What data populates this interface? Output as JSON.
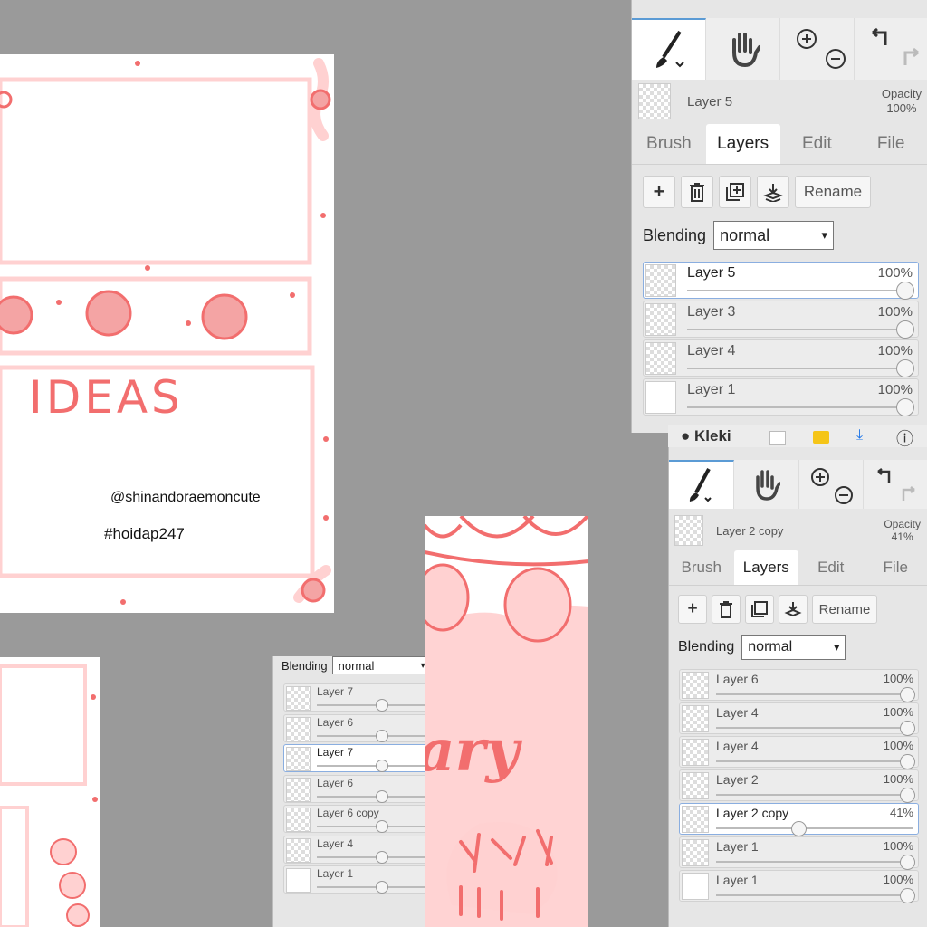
{
  "canvas1": {
    "ideas_text": "IDEAS",
    "handle": "@shinandoraemoncute",
    "hashtag": "#hoidap247"
  },
  "canvas2": {
    "art_text": "ary"
  },
  "panel_top": {
    "current_layer": "Layer 5",
    "opacity_label": "Opacity",
    "opacity_value": "100%",
    "tabs": [
      "Brush",
      "Layers",
      "Edit",
      "File"
    ],
    "rename": "Rename",
    "blending_label": "Blending",
    "blending_value": "normal",
    "layers": [
      {
        "name": "Layer 5",
        "opacity": "100%",
        "level": 1.0,
        "selected": true
      },
      {
        "name": "Layer 3",
        "opacity": "100%",
        "level": 1.0,
        "selected": false
      },
      {
        "name": "Layer 4",
        "opacity": "100%",
        "level": 1.0,
        "selected": false
      },
      {
        "name": "Layer 1",
        "opacity": "100%",
        "level": 1.0,
        "selected": false
      }
    ]
  },
  "kleki_bar": {
    "logo_text": "Kleki"
  },
  "panel_right": {
    "current_layer": "Layer 2 copy",
    "opacity_label": "Opacity",
    "opacity_value": "41%",
    "tabs": [
      "Brush",
      "Layers",
      "Edit",
      "File"
    ],
    "rename": "Rename",
    "blending_label": "Blending",
    "blending_value": "normal",
    "layers": [
      {
        "name": "Layer 6",
        "opacity": "100%",
        "level": 1.0,
        "selected": false
      },
      {
        "name": "Layer 4",
        "opacity": "100%",
        "level": 1.0,
        "selected": false
      },
      {
        "name": "Layer 4",
        "opacity": "100%",
        "level": 1.0,
        "selected": false
      },
      {
        "name": "Layer 2",
        "opacity": "100%",
        "level": 1.0,
        "selected": false
      },
      {
        "name": "Layer 2 copy",
        "opacity": "41%",
        "level": 0.41,
        "selected": true
      },
      {
        "name": "Layer 1",
        "opacity": "100%",
        "level": 1.0,
        "selected": false
      },
      {
        "name": "Layer 1",
        "opacity": "100%",
        "level": 1.0,
        "selected": false
      }
    ]
  },
  "panel_small": {
    "blending_label": "Blending",
    "blending_value": "normal",
    "layers": [
      {
        "name": "Layer 7",
        "selected": false
      },
      {
        "name": "Layer 6",
        "selected": false
      },
      {
        "name": "Layer 7",
        "selected": true
      },
      {
        "name": "Layer 6",
        "selected": false
      },
      {
        "name": "Layer 6 copy",
        "selected": false
      },
      {
        "name": "Layer 4",
        "selected": false
      },
      {
        "name": "Layer 1",
        "selected": false
      }
    ]
  },
  "colors": {
    "pink": "#f26e6e",
    "light_pink": "#ffd1d1",
    "bg": "#9a9a9a",
    "accent": "#5b9bd5"
  },
  "icons": [
    "brush-icon",
    "hand-icon",
    "zoom-in-icon",
    "zoom-out-icon",
    "undo-icon",
    "redo-icon",
    "add-layer-icon",
    "delete-layer-icon",
    "duplicate-layer-icon",
    "merge-down-icon",
    "help-icon"
  ]
}
